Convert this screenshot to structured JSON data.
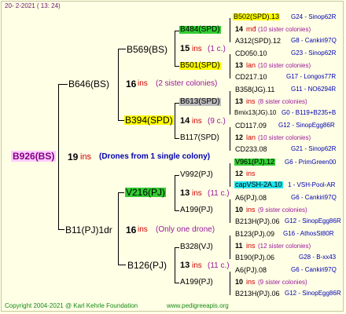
{
  "header": {
    "date": "20- 2-2021 ( 13: 24)"
  },
  "colors": {
    "spd_green": "#33cc33",
    "spd_yellow": "#ffff00",
    "spd_gray": "#bbbbbb",
    "spd_cyan": "#22e6f0",
    "red": "#d00000",
    "blue": "#0000b0",
    "magenta": "#9a189a"
  },
  "root": {
    "name": "B926(BS)",
    "count": "19",
    "ins": "ins",
    "note": "(Drones from 1 single colony)"
  },
  "gen1": {
    "top": {
      "name": "B646(BS)",
      "count": "16",
      "ins": "ins",
      "note": "(2 sister colonies)"
    },
    "bottom": {
      "name": "B11(PJ)1dr",
      "count": "16",
      "ins": "ins",
      "note": "(Only one drone)"
    }
  },
  "gen2": {
    "a": {
      "name": "B569(BS)",
      "count": "15",
      "ins": "ins",
      "note": "(1 c.)"
    },
    "b": {
      "name": "B394(SPD)",
      "count": "14",
      "ins": "ins",
      "note": "(9 c.)"
    },
    "c": {
      "name": "V216(PJ)",
      "count": "13",
      "ins": "ins",
      "note": "(11 c.)"
    },
    "d": {
      "name": "B126(PJ)",
      "count": "13",
      "ins": "ins",
      "note": "(11 c.)"
    }
  },
  "gen3": {
    "a1": {
      "name": "B484(SPD)"
    },
    "a2": {
      "name": "B501(SPD)"
    },
    "b1": {
      "name": "B613(SPD)",
      "count": "13",
      "ins": "ins",
      "note": "(8 sister colonies)"
    },
    "b2": {
      "name": "B117(SPD)",
      "count": "12",
      "ins": "lan",
      "note": "(10 sister colonies)"
    },
    "c1": {
      "name": "V992(PJ)",
      "count": "12",
      "ins": "ins"
    },
    "c2": {
      "name": "A199(PJ)",
      "count": "10",
      "ins": "ins",
      "note": "(9 sister colonies)"
    },
    "d1": {
      "name": "B328(VJ)",
      "count": "11",
      "ins": "ins",
      "note": "(12 sister colonies)"
    },
    "d2": {
      "name": "A199(PJ)",
      "count": "10",
      "ins": "ins",
      "note": "(9 sister colonies)"
    }
  },
  "gen4": [
    {
      "name": "B502(SPD).13",
      "src": "G24 - Sinop62R"
    },
    {
      "count": "14",
      "ins": "mđ",
      "note": "(10 sister colonies)"
    },
    {
      "name": "A312(SPD).12",
      "src": "G8 - Cankiri97Q"
    },
    {
      "name": "CD050.10",
      "src": "G23 - Sinop62R"
    },
    {
      "count": "13",
      "ins": "lan",
      "note": "(10 sister colonies)"
    },
    {
      "name": "CD217.10",
      "src": "G17 - Longos77R"
    },
    {
      "name": "B358(JG).11",
      "src": "G11 - NO6294R"
    },
    {
      "name": "Bmix13(JG).10",
      "src": "G0 - B119+B235+B"
    },
    {
      "name": "CD117.09",
      "src": "G12 - SinopEgg86R"
    },
    {
      "name": "CD233.08",
      "src": "G21 - Sinop62R"
    },
    {
      "name": "V961(PJ).12",
      "src": "G6 - PrimGreen00"
    },
    {
      "name": "capVSH-2A.10",
      "src": "1 - VSH-Pool-AR"
    },
    {
      "name": "A6(PJ).08",
      "src": "G6 - Cankiri97Q"
    },
    {
      "name": "B213H(PJ).06",
      "src": "G12 - SinopEgg86R"
    },
    {
      "name": "B123(PJ).09",
      "src": "G16 - AthosSt80R"
    },
    {
      "name": "B190(PJ).06",
      "src": "G28 - B-xx43"
    },
    {
      "name": "A6(PJ).08",
      "src": "G6 - Cankiri97Q"
    },
    {
      "name": "B213H(PJ).06",
      "src": "G12 - SinopEgg86R"
    }
  ],
  "footer": {
    "copyright": "Copyright 2004-2021 @ Karl Kehrle Foundation",
    "url": "www.pedigreeapis.org"
  }
}
